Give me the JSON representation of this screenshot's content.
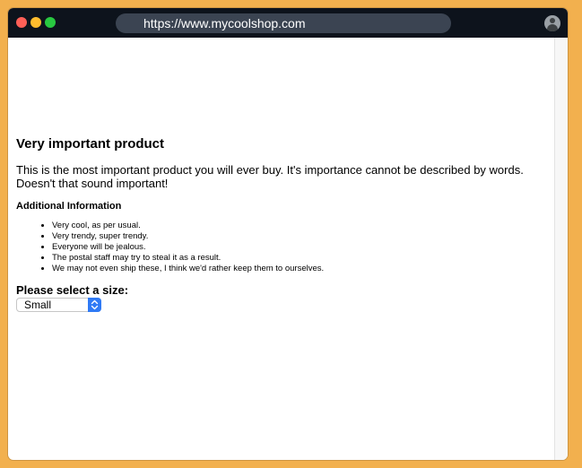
{
  "browser": {
    "url": "https://www.mycoolshop.com"
  },
  "product": {
    "title": "Very important product",
    "description": "This is the most important product you will ever buy. It's importance cannot be described by words. Doesn't that sound important!",
    "info_heading": "Additional Information",
    "features": [
      "Very cool, as per usual.",
      "Very trendy, super trendy.",
      "Everyone will be jealous.",
      "The postal staff may try to steal it as a result.",
      "We may not even ship these, I think we'd rather keep them to ourselves."
    ],
    "size_label": "Please select a size:",
    "size_selected": "Small"
  },
  "colors": {
    "page_background": "#f2b04e",
    "titlebar": "#0d131c",
    "urlbar": "#3b4452",
    "select_accent": "#2f7af5"
  },
  "icons": {
    "window_controls": [
      "close-dot",
      "minimize-dot",
      "zoom-dot"
    ],
    "profile": "profile-icon",
    "select_arrow": "chevron-updown-icon"
  }
}
